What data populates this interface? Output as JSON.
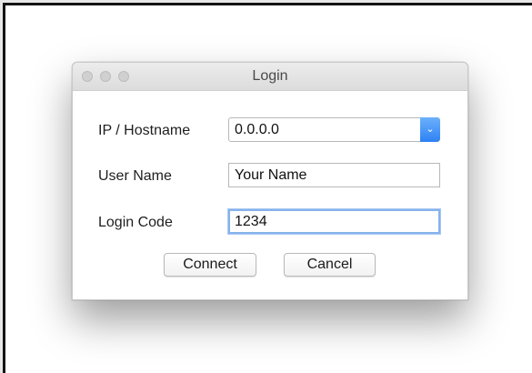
{
  "dialog": {
    "title": "Login",
    "fields": {
      "host_label": "IP / Hostname",
      "host_value": "0.0.0.0",
      "user_label": "User Name",
      "user_value": "Your Name",
      "code_label": "Login Code",
      "code_value": "1234"
    },
    "buttons": {
      "connect": "Connect",
      "cancel": "Cancel"
    }
  },
  "icons": {
    "dropdown": "chevron-down-icon",
    "window_controls": [
      "close-icon",
      "minimize-icon",
      "zoom-icon"
    ]
  },
  "colors": {
    "accent": "#3b8ef6",
    "focus_ring": "#86b2ec"
  }
}
